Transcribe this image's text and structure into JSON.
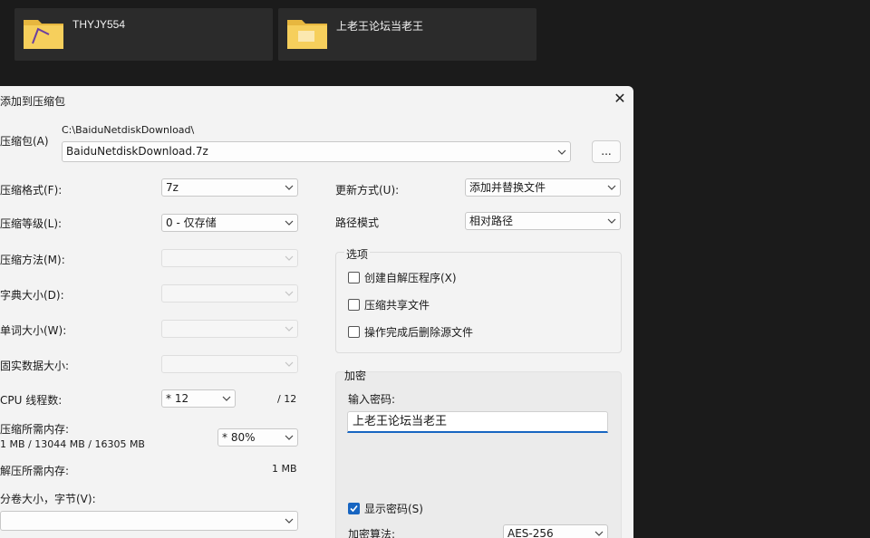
{
  "explorer": {
    "folders": [
      {
        "name": "THYJY554"
      },
      {
        "name": "上老王论坛当老王"
      }
    ]
  },
  "dialog": {
    "title": "添加到压缩包",
    "close_glyph": "✕",
    "archive": {
      "label": "压缩包(A)",
      "path": "C:\\BaiduNetdiskDownload\\",
      "value": "BaiduNetdiskDownload.7z",
      "browse_label": "..."
    },
    "left": {
      "format": {
        "label": "压缩格式(F):",
        "value": "7z"
      },
      "level": {
        "label": "压缩等级(L):",
        "value": "0 - 仅存储"
      },
      "method": {
        "label": "压缩方法(M):",
        "value": ""
      },
      "dict": {
        "label": "字典大小(D):",
        "value": ""
      },
      "word": {
        "label": "单词大小(W):",
        "value": ""
      },
      "solid": {
        "label": "固实数据大小:",
        "value": ""
      },
      "threads": {
        "label": "CPU 线程数:",
        "value": "* 12",
        "max": "/ 12"
      },
      "mem_compress": {
        "label": "压缩所需内存:",
        "detail": "1 MB / 13044 MB / 16305 MB",
        "value": "* 80%"
      },
      "mem_decompress": {
        "label": "解压所需内存:",
        "value": "1 MB"
      },
      "volume": {
        "label": "分卷大小，字节(V):",
        "value": ""
      }
    },
    "right": {
      "update": {
        "label": "更新方式(U):",
        "value": "添加并替换文件"
      },
      "pathmode": {
        "label": "路径模式",
        "value": "相对路径"
      },
      "options": {
        "title": "选项",
        "items": [
          {
            "label": "创建自解压程序(X)",
            "checked": false
          },
          {
            "label": "压缩共享文件",
            "checked": false
          },
          {
            "label": "操作完成后删除源文件",
            "checked": false
          }
        ]
      },
      "encryption": {
        "title": "加密",
        "password_label": "输入密码:",
        "password_value": "上老王论坛当老王",
        "show_password": {
          "label": "显示密码(S)",
          "checked": true
        },
        "method_label": "加密算法:",
        "method_value": "AES-256"
      }
    }
  },
  "colors": {
    "accent": "#1765c1",
    "desktop": "#1b1b1b",
    "dialog": "#f3f3f3"
  }
}
